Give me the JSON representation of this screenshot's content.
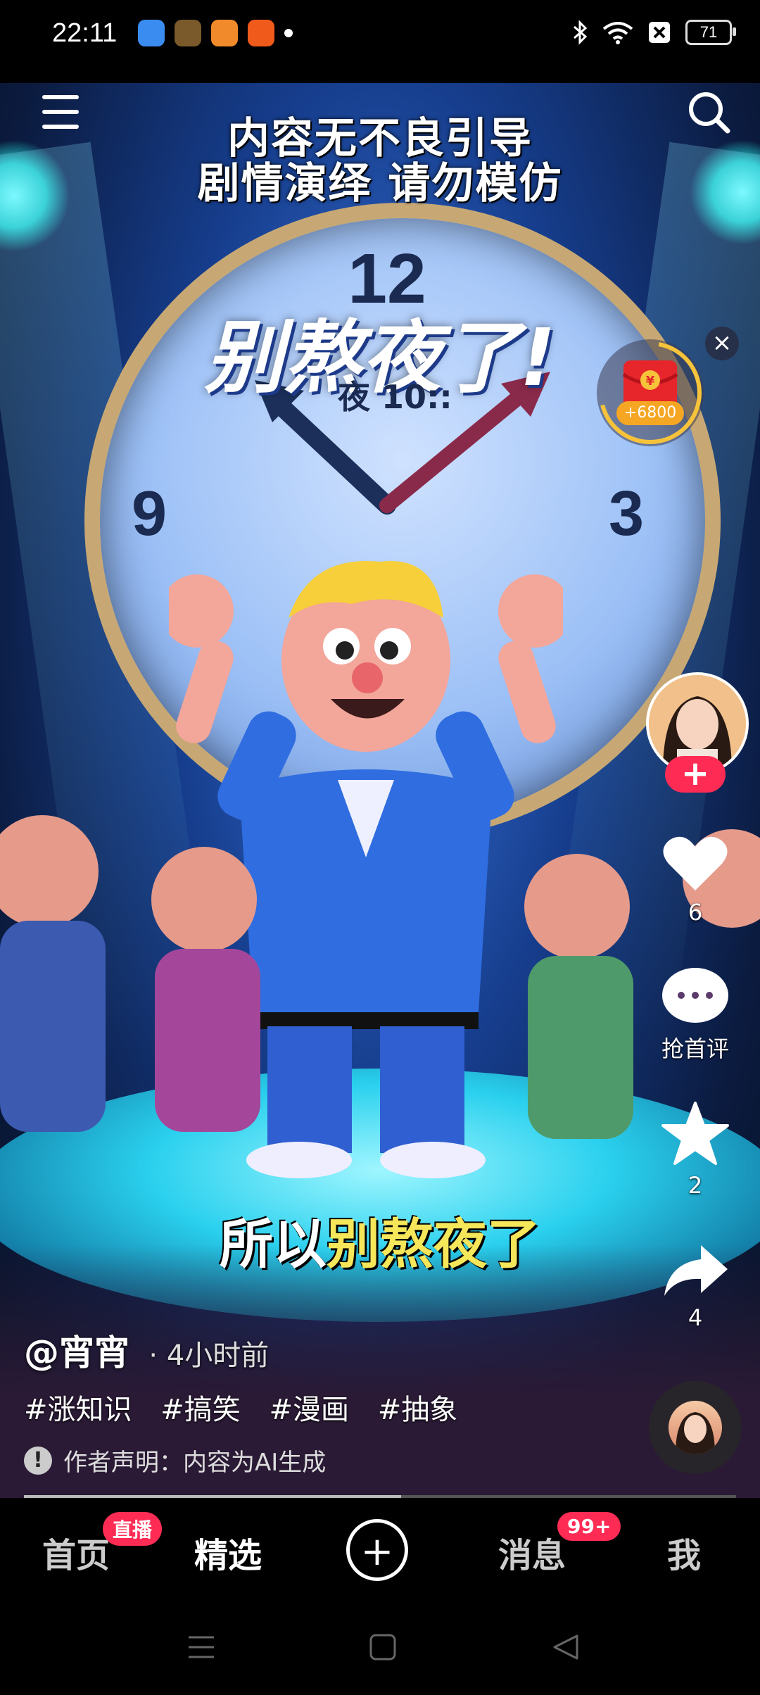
{
  "status_bar": {
    "time": "22:11",
    "battery": "71"
  },
  "video": {
    "notice_line1": "内容无不良引导",
    "notice_line2": "剧情演绎  请勿模仿",
    "title": "别熬夜了!",
    "clock_caption": "夜 10::",
    "subtitle_plain": "所以",
    "subtitle_highlight": "别熬夜了"
  },
  "red_packet": {
    "amount": "+6800"
  },
  "rail": {
    "likes": "6",
    "comment_label": "抢首评",
    "favorites": "2",
    "shares": "4"
  },
  "post": {
    "author": "@宵宵",
    "time_ago": "· 4小时前",
    "tags": [
      "#涨知识",
      "#搞笑",
      "#漫画",
      "#抽象"
    ],
    "declaration": "作者声明：内容为AI生成"
  },
  "progress": {
    "fraction": 0.53
  },
  "nav": {
    "home": "首页",
    "home_badge": "直播",
    "featured": "精选",
    "messages": "消息",
    "messages_badge": "99+",
    "me": "我"
  },
  "colors": {
    "accent": "#fe2c55",
    "highlight": "#f5e65a"
  }
}
